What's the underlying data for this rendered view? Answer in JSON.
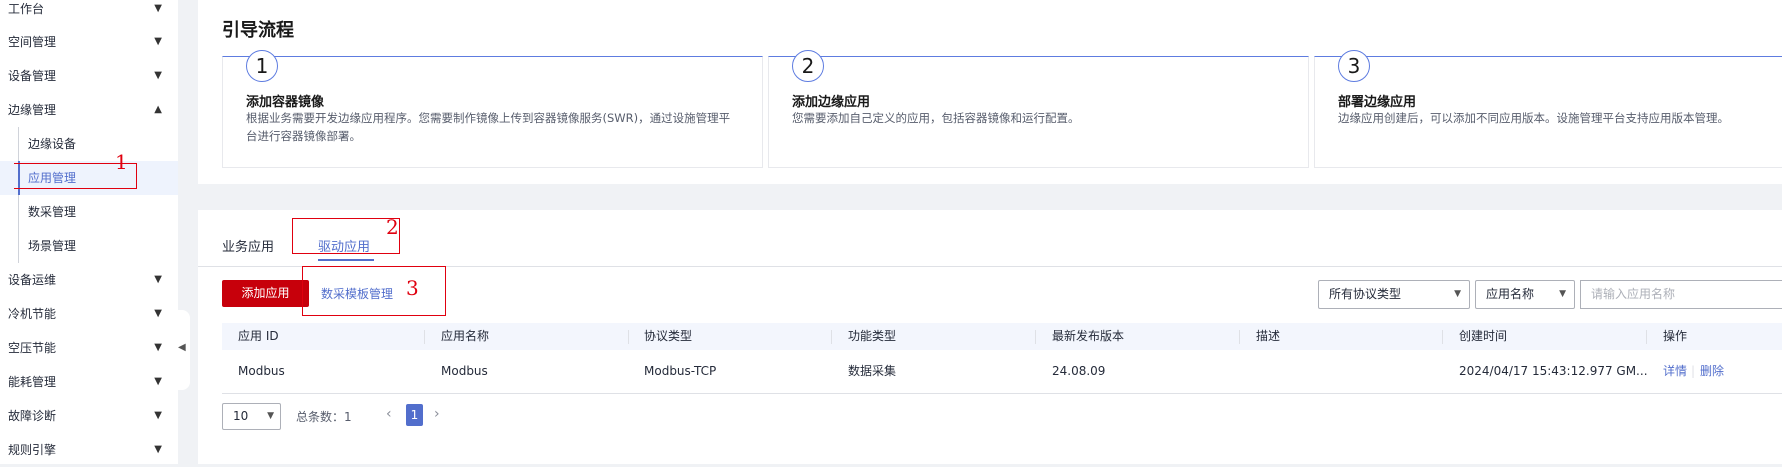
{
  "sidebar": {
    "items": [
      {
        "label": "工作台",
        "arrow": "▼"
      },
      {
        "label": "空间管理",
        "arrow": "▼"
      },
      {
        "label": "设备管理",
        "arrow": "▼"
      },
      {
        "label": "边缘管理",
        "arrow": "▲"
      },
      {
        "label": "边缘设备"
      },
      {
        "label": "应用管理"
      },
      {
        "label": "数采管理"
      },
      {
        "label": "场景管理"
      },
      {
        "label": "设备运维",
        "arrow": "▼"
      },
      {
        "label": "冷机节能",
        "arrow": "▼"
      },
      {
        "label": "空压节能",
        "arrow": "▼"
      },
      {
        "label": "能耗管理",
        "arrow": "▼"
      },
      {
        "label": "故障诊断",
        "arrow": "▼"
      },
      {
        "label": "规则引擎",
        "arrow": "▼"
      }
    ],
    "collapse_icon": "◀"
  },
  "annotations": [
    "1",
    "2",
    "3"
  ],
  "guide": {
    "title": "引导流程",
    "steps": [
      {
        "num": "1",
        "title": "添加容器镜像",
        "desc": "根据业务需要开发边缘应用程序。您需要制作镜像上传到容器镜像服务(SWR)，通过设施管理平台进行容器镜像部署。"
      },
      {
        "num": "2",
        "title": "添加边缘应用",
        "desc": "您需要添加自己定义的应用，包括容器镜像和运行配置。"
      },
      {
        "num": "3",
        "title": "部署边缘应用",
        "desc": "边缘应用创建后，可以添加不同应用版本。设施管理平台支持应用版本管理。"
      }
    ]
  },
  "tabs": {
    "business": "业务应用",
    "driver": "驱动应用"
  },
  "toolbar": {
    "add_label": "添加应用",
    "template_label": "数采模板管理",
    "protocol_select": "所有协议类型",
    "field_select": "应用名称",
    "search_placeholder": "请输入应用名称"
  },
  "table": {
    "headers": [
      "应用 ID",
      "应用名称",
      "协议类型",
      "功能类型",
      "最新发布版本",
      "描述",
      "创建时间",
      "操作"
    ],
    "rows": [
      {
        "id": "Modbus",
        "name": "Modbus",
        "protocol": "Modbus-TCP",
        "function": "数据采集",
        "version": "24.08.09",
        "desc": "",
        "created": "2024/04/17 15:43:12.977 GM...",
        "detail": "详情",
        "sep": "|",
        "delete": "删除"
      }
    ]
  },
  "pagination": {
    "page_size": "10",
    "total": "总条数：1",
    "current": "1",
    "prev": "‹",
    "next": "›"
  },
  "colors": {
    "accent": "#526ecc",
    "primary_button": "#c7000b",
    "annotation": "#e0000f"
  }
}
